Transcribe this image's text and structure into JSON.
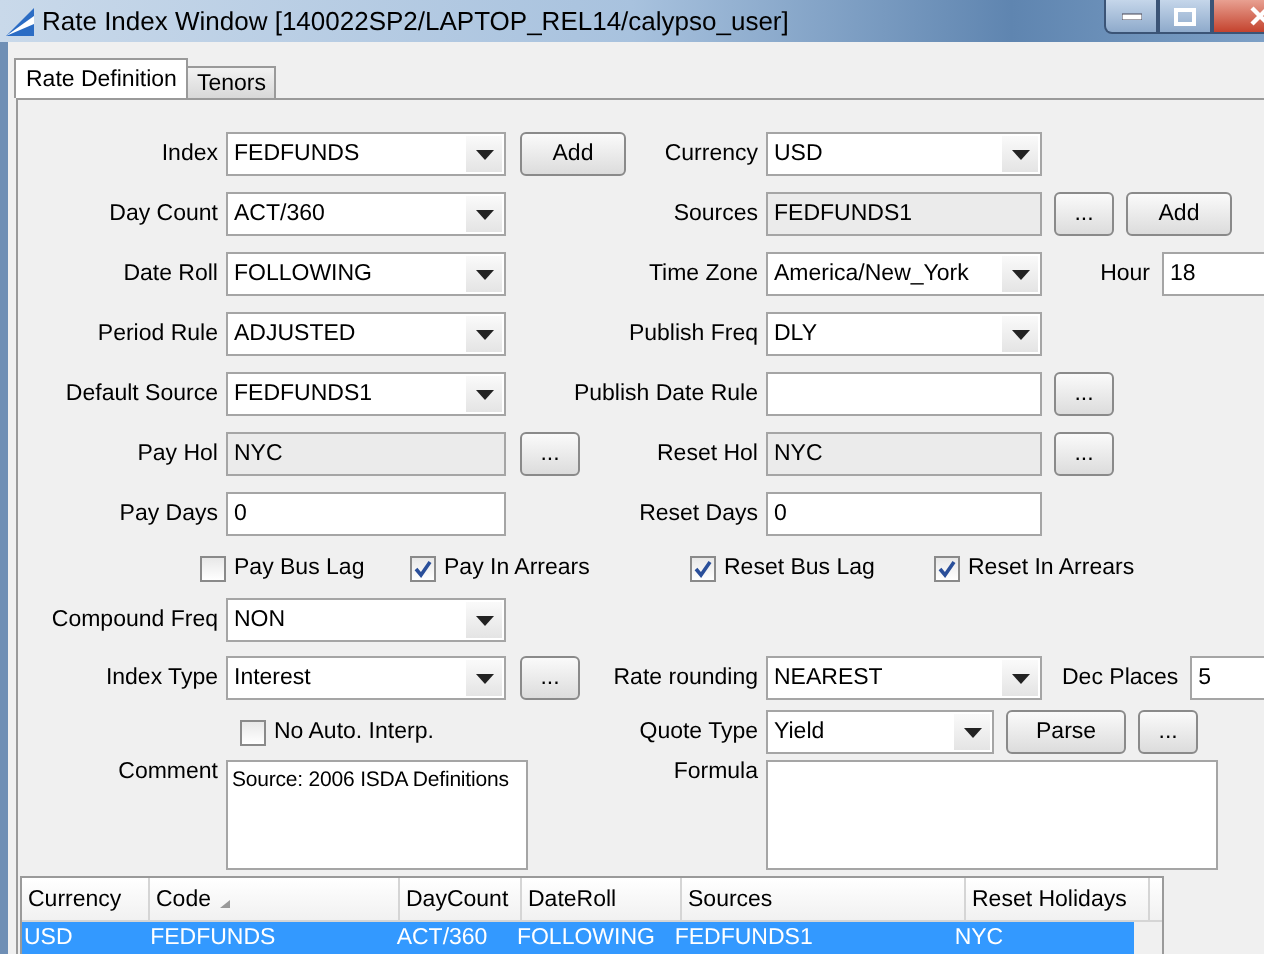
{
  "window": {
    "title": "Rate Index Window  [140022SP2/LAPTOP_REL14/calypso_user]"
  },
  "tabs": [
    {
      "label": "Rate Definition",
      "selected": true
    },
    {
      "label": "Tenors",
      "selected": false
    }
  ],
  "rows": [
    {
      "kind": "fields",
      "left": [
        {
          "kind": "label",
          "text": "Index"
        },
        {
          "kind": "dropdown",
          "value": "FEDFUNDS"
        },
        {
          "kind": "button",
          "label": "Add"
        }
      ],
      "right": [
        {
          "kind": "label",
          "text": "Currency"
        },
        {
          "kind": "dropdown",
          "value": "USD"
        }
      ]
    },
    {
      "kind": "fields",
      "left": [
        {
          "kind": "label",
          "text": "Day Count"
        },
        {
          "kind": "dropdown",
          "value": "ACT/360"
        }
      ],
      "right": [
        {
          "kind": "label",
          "text": "Sources"
        },
        {
          "kind": "readonly",
          "value": "FEDFUNDS1"
        },
        {
          "kind": "browse",
          "label": "..."
        },
        {
          "kind": "button",
          "label": "Add"
        }
      ]
    },
    {
      "kind": "fields",
      "left": [
        {
          "kind": "label",
          "text": "Date Roll"
        },
        {
          "kind": "dropdown",
          "value": "FOLLOWING"
        }
      ],
      "right": [
        {
          "kind": "label",
          "text": "Time Zone"
        },
        {
          "kind": "dropdown",
          "value": "America/New_York"
        },
        {
          "kind": "label",
          "text": "Hour"
        },
        {
          "kind": "text",
          "value": "18"
        }
      ]
    },
    {
      "kind": "fields",
      "left": [
        {
          "kind": "label",
          "text": "Period Rule"
        },
        {
          "kind": "dropdown",
          "value": "ADJUSTED"
        }
      ],
      "right": [
        {
          "kind": "label",
          "text": "Publish Freq"
        },
        {
          "kind": "dropdown",
          "value": "DLY"
        }
      ]
    },
    {
      "kind": "fields",
      "left": [
        {
          "kind": "label",
          "text": "Default Source"
        },
        {
          "kind": "dropdown",
          "value": "FEDFUNDS1"
        }
      ],
      "right": [
        {
          "kind": "label",
          "text": "Publish Date Rule"
        },
        {
          "kind": "text"
        },
        {
          "kind": "browse",
          "label": "..."
        }
      ]
    },
    {
      "kind": "fields",
      "left": [
        {
          "kind": "label",
          "text": "Pay Hol"
        },
        {
          "kind": "readonly",
          "value": "NYC"
        },
        {
          "kind": "browse",
          "label": "..."
        }
      ],
      "right": [
        {
          "kind": "label",
          "text": "Reset Hol"
        },
        {
          "kind": "readonly",
          "value": "NYC"
        },
        {
          "kind": "browse",
          "label": "..."
        }
      ]
    },
    {
      "kind": "fields",
      "left": [
        {
          "kind": "label",
          "text": "Pay Days"
        },
        {
          "kind": "text",
          "value": "0"
        }
      ],
      "right": [
        {
          "kind": "label",
          "text": "Reset Days"
        },
        {
          "kind": "text",
          "value": "0"
        }
      ]
    },
    {
      "kind": "checks",
      "items": [
        {
          "label": "Pay Bus Lag",
          "checked": false
        },
        {
          "label": "Pay In Arrears",
          "checked": true
        },
        {
          "label": "Reset Bus Lag",
          "checked": true
        },
        {
          "label": "Reset In Arrears",
          "checked": true
        }
      ]
    },
    {
      "kind": "fields",
      "left": [
        {
          "kind": "label",
          "text": "Compound Freq"
        },
        {
          "kind": "dropdown",
          "value": "NON"
        }
      ],
      "right": []
    },
    {
      "kind": "fields",
      "left": [
        {
          "kind": "label",
          "text": "Index Type"
        },
        {
          "kind": "dropdown",
          "value": "Interest"
        },
        {
          "kind": "browse",
          "label": "..."
        }
      ],
      "right": [
        {
          "kind": "label",
          "text": "Rate rounding"
        },
        {
          "kind": "dropdown",
          "value": "NEAREST"
        },
        {
          "kind": "label",
          "text": "Dec Places"
        },
        {
          "kind": "text",
          "value": "5"
        }
      ]
    },
    {
      "kind": "fields",
      "left": [
        {
          "kind": "checkbox",
          "label": "No Auto. Interp.",
          "checked": false
        }
      ],
      "right": [
        {
          "kind": "label",
          "text": "Quote Type"
        },
        {
          "kind": "dropdown",
          "value": "Yield"
        },
        {
          "kind": "button",
          "label": "Parse"
        },
        {
          "kind": "browse",
          "label": "..."
        }
      ]
    },
    {
      "kind": "areas",
      "left": [
        {
          "kind": "label",
          "text": "Comment"
        },
        {
          "kind": "textarea",
          "value": "Source: 2006 ISDA Definitions"
        }
      ],
      "right": [
        {
          "kind": "label",
          "text": "Formula"
        },
        {
          "kind": "textarea"
        }
      ]
    }
  ],
  "table": {
    "columns": [
      {
        "label": "Currency",
        "sorted": false
      },
      {
        "label": "Code",
        "sorted": true
      },
      {
        "label": "DayCount",
        "sorted": false
      },
      {
        "label": "DateRoll",
        "sorted": false
      },
      {
        "label": "Sources",
        "sorted": false
      },
      {
        "label": "Reset Holidays",
        "sorted": false
      }
    ],
    "rows": [
      {
        "selected": true,
        "cells": [
          "USD",
          "FEDFUNDS",
          "ACT/360",
          "FOLLOWING",
          "FEDFUNDS1",
          "NYC"
        ]
      }
    ]
  }
}
